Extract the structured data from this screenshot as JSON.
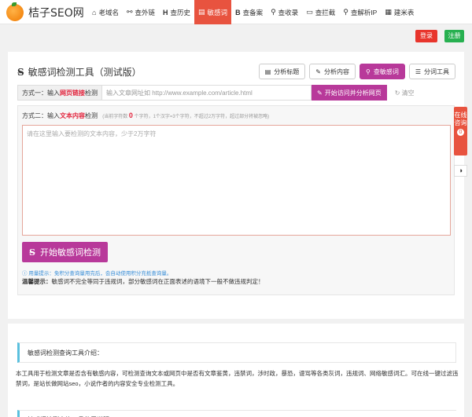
{
  "header": {
    "logo_text": "桔子SEO网",
    "nav": [
      {
        "label": "老域名",
        "icon": "home-icon"
      },
      {
        "label": "查外链",
        "icon": "link-icon"
      },
      {
        "label": "查历史",
        "icon": "history-icon"
      },
      {
        "label": "敏感词",
        "icon": "document-icon"
      },
      {
        "label": "查备案",
        "icon": "bold-b-icon"
      },
      {
        "label": "查收录",
        "icon": "search-icon"
      },
      {
        "label": "查拦截",
        "icon": "folder-icon"
      },
      {
        "label": "查解析IP",
        "icon": "location-icon"
      },
      {
        "label": "建米表",
        "icon": "grid-icon"
      }
    ],
    "login_label": "登录",
    "register_label": "注册",
    "colors": {
      "accent": "#b8399a",
      "nav_active": "#e8533f",
      "login": "#e8352c",
      "register": "#27b050"
    }
  },
  "tool": {
    "title": "敏感词检测工具（测试版）",
    "tabs": [
      {
        "label": "分析标题",
        "icon": "document-icon"
      },
      {
        "label": "分析内容",
        "icon": "edit-icon"
      },
      {
        "label": "查敏感词",
        "icon": "search-icon"
      },
      {
        "label": "分词工具",
        "icon": "list-icon"
      }
    ],
    "method1": {
      "prefix": "方式一：输入",
      "highlight": "网页链接",
      "suffix": "检测"
    },
    "url_placeholder": "输入文章网址如 http://www.example.com/article.html",
    "url_button": "开始访问并分析网页",
    "clear_label": "清空",
    "method2": {
      "prefix": "方式二：输入",
      "highlight": "文本内容",
      "suffix": "检测",
      "meta_prefix": "(当前字符数",
      "count": "0",
      "meta_suffix": "个字符，1个汉字=3个字符，不超过2万字符，超过部分将被忽略)"
    },
    "textarea_placeholder": "请在这里输入要检测的文本内容，少于2万字符",
    "start_button": "开始敏感词检测",
    "hint": "用量提示：免积分查询量用完后，会自动使用积分充抵查询量。",
    "warm_label": "温馨提示：",
    "warm_text": "敏感词不完全等同于违规词，部分敏感词在正面表述的语境下一般不做违规判定！"
  },
  "side": {
    "consult_label": "在线咨询",
    "consult_badge": "0",
    "theme_icon": "contrast-icon"
  },
  "intro": {
    "heading": "敏感词检测查询工具介绍：",
    "text": "本工具用于检测文章是否含有敏感内容，可检测查询文本或网页中是否有文章鉴黄，违禁词，涉时政，暴恐，谩骂等各类灰词，违规词、网络敏感词汇。可在线一键过滤违禁词，是站长做网站seo，小说作者的内容安全专业检测工具。",
    "heading2": "敏感词检测查询工具使用说明："
  }
}
